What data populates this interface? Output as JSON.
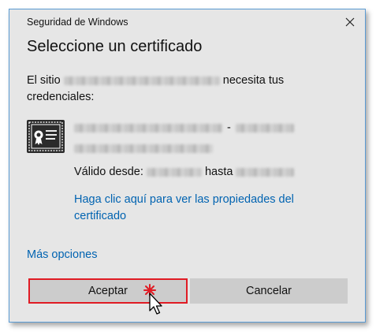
{
  "window": {
    "title": "Seguridad de Windows"
  },
  "dialog": {
    "heading": "Seleccione un certificado",
    "site_prefix": "El sitio",
    "site_suffix": "necesita tus credenciales:"
  },
  "certificate": {
    "name_separator": "-",
    "valid_from_label": "Válido desde:",
    "valid_to_label": "hasta",
    "properties_link": "Haga clic aquí para ver las propiedades del certificado"
  },
  "footer": {
    "more_options_link": "Más opciones",
    "accept_label": "Aceptar",
    "cancel_label": "Cancelar"
  },
  "colors": {
    "dialog_background": "#e6e6e6",
    "window_border": "#5a9bd4",
    "link": "#0063b1",
    "button": "#cccccc",
    "highlight": "#e01b24"
  },
  "icons": [
    "close-icon",
    "certificate-icon",
    "click-star-icon",
    "mouse-cursor-icon"
  ]
}
